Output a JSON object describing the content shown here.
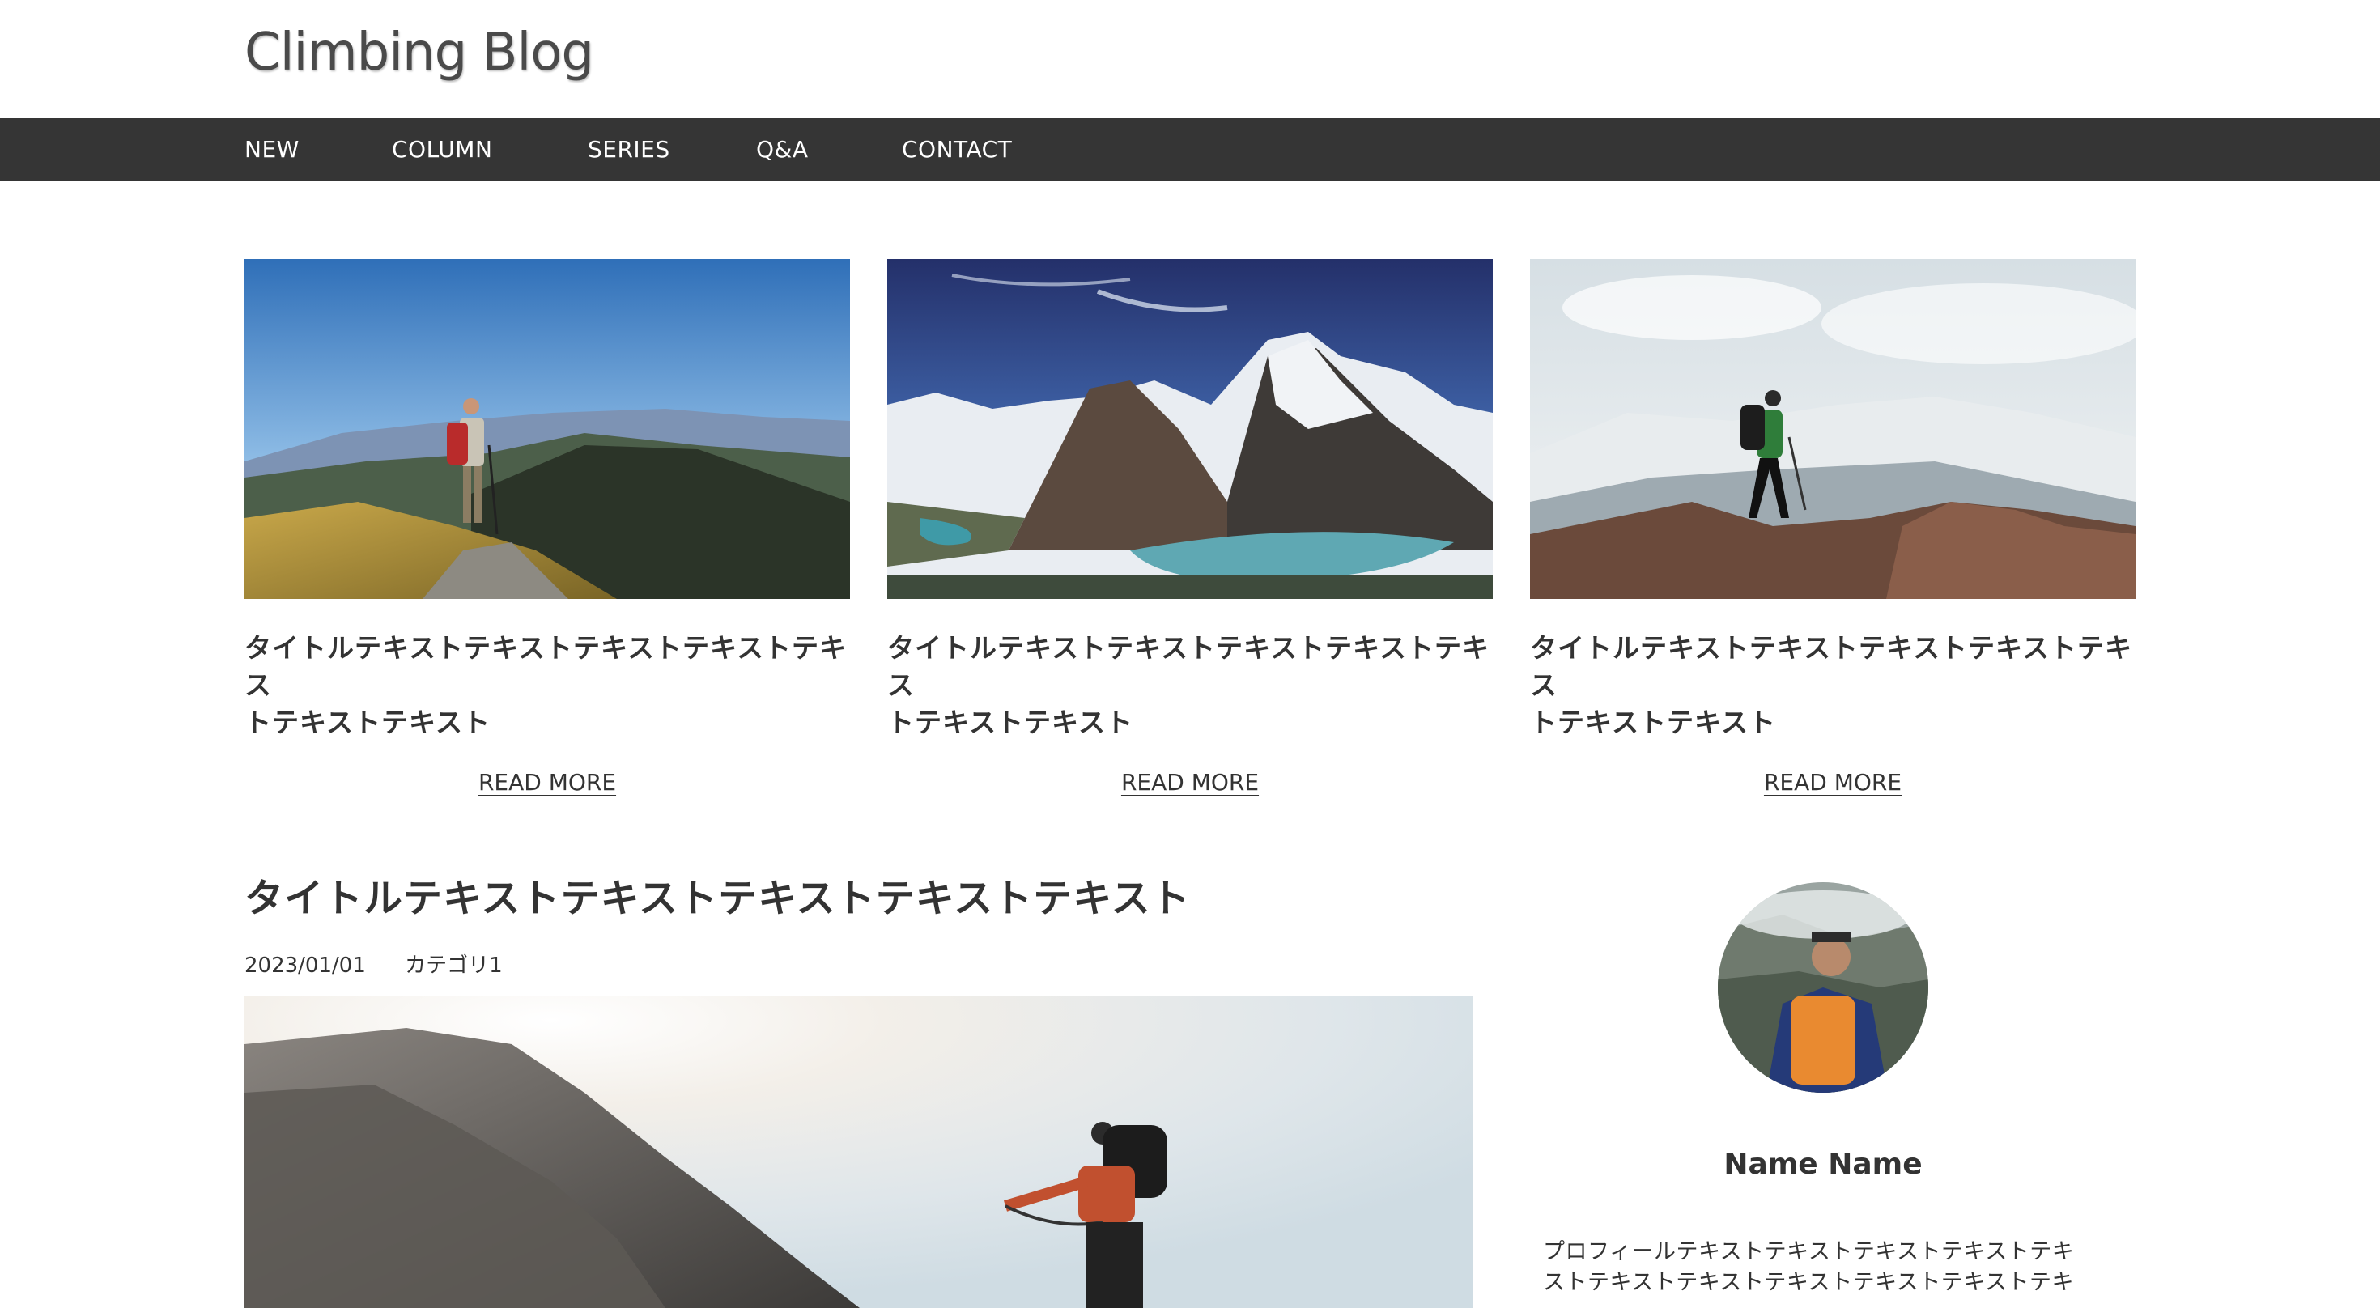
{
  "header": {
    "logo": "Climbing Blog"
  },
  "nav": {
    "items": [
      {
        "id": "new",
        "label": "NEW"
      },
      {
        "id": "column",
        "label": "COLUMN"
      },
      {
        "id": "series",
        "label": "SERIES"
      },
      {
        "id": "qa",
        "label": "Q&A"
      },
      {
        "id": "contact",
        "label": "CONTACT"
      }
    ]
  },
  "cards": [
    {
      "title_line1": "タイトルテキストテキストテキストテキストテキス",
      "title_line2": "トテキストテキスト",
      "read_more": "READ MORE"
    },
    {
      "title_line1": "タイトルテキストテキストテキストテキストテキス",
      "title_line2": "トテキストテキスト",
      "read_more": "READ MORE"
    },
    {
      "title_line1": "タイトルテキストテキストテキストテキストテキス",
      "title_line2": "トテキストテキスト",
      "read_more": "READ MORE"
    }
  ],
  "post": {
    "title": "タイトルテキストテキストテキストテキストテキスト",
    "date": "2023/01/01",
    "category": "カテゴリ1"
  },
  "profile": {
    "name": "Name Name",
    "text_line1": "プロフィールテキストテキストテキストテキストテキ",
    "text_line2": "ストテキストテキストテキストテキストテキストテキ"
  }
}
